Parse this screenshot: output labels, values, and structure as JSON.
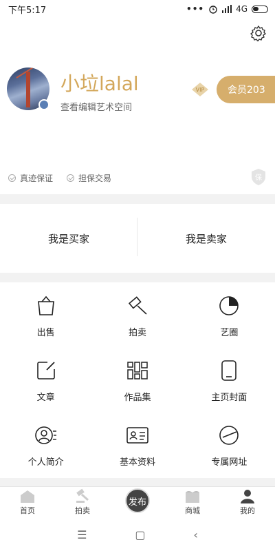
{
  "status_bar": {
    "time": "下午5:17",
    "dots": "•••",
    "network": "4G",
    "icons": [
      "alarm-icon",
      "signal-icon",
      "battery-icon"
    ]
  },
  "profile": {
    "username": "小垃lalal",
    "subtitle": "查看编辑艺术空间",
    "vip_label": "VIP",
    "member_button": "会员203",
    "guarantees": [
      "真迹保证",
      "担保交易"
    ],
    "shield_label": "保",
    "accent_color": "#d6ae6c"
  },
  "roles": {
    "buyer": "我是买家",
    "seller": "我是卖家"
  },
  "menu": {
    "items": [
      {
        "label": "出售",
        "icon": "basket-icon"
      },
      {
        "label": "拍卖",
        "icon": "gavel-icon"
      },
      {
        "label": "艺圈",
        "icon": "circle-icon"
      },
      {
        "label": "文章",
        "icon": "edit-icon"
      },
      {
        "label": "作品集",
        "icon": "gallery-icon"
      },
      {
        "label": "主页封面",
        "icon": "phone-icon"
      },
      {
        "label": "个人简介",
        "icon": "profile-icon"
      },
      {
        "label": "基本资料",
        "icon": "id-card-icon"
      },
      {
        "label": "专属网址",
        "icon": "link-icon"
      }
    ]
  },
  "tabbar": {
    "items": [
      {
        "label": "首页",
        "icon": "home-icon"
      },
      {
        "label": "拍卖",
        "icon": "gavel-icon"
      },
      {
        "label": "发布",
        "icon": "publish-icon"
      },
      {
        "label": "商城",
        "icon": "shop-icon"
      },
      {
        "label": "我的",
        "icon": "user-icon"
      }
    ],
    "active": "我的"
  },
  "navbar": {
    "menu": "☰",
    "home": "▢",
    "back": "‹"
  }
}
